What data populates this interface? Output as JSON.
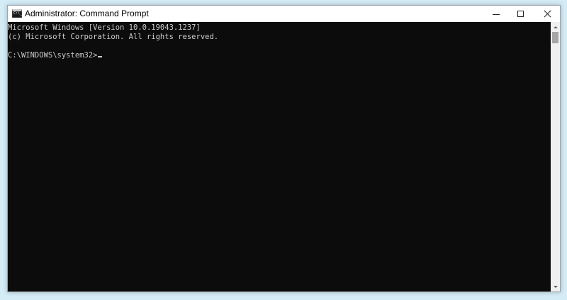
{
  "window": {
    "title": "Administrator: Command Prompt",
    "icon": "cmd-icon"
  },
  "caption_buttons": {
    "minimize": "minimize-icon",
    "maximize": "maximize-icon",
    "close": "close-icon"
  },
  "console": {
    "lines": [
      "Microsoft Windows [Version 10.0.19043.1237]",
      "(c) Microsoft Corporation. All rights reserved.",
      "",
      "C:\\WINDOWS\\system32>"
    ]
  },
  "colors": {
    "console_background": "#0c0c0c",
    "console_text": "#cccccc",
    "titlebar": "#ffffff",
    "desktop": "#d4ecf6"
  }
}
